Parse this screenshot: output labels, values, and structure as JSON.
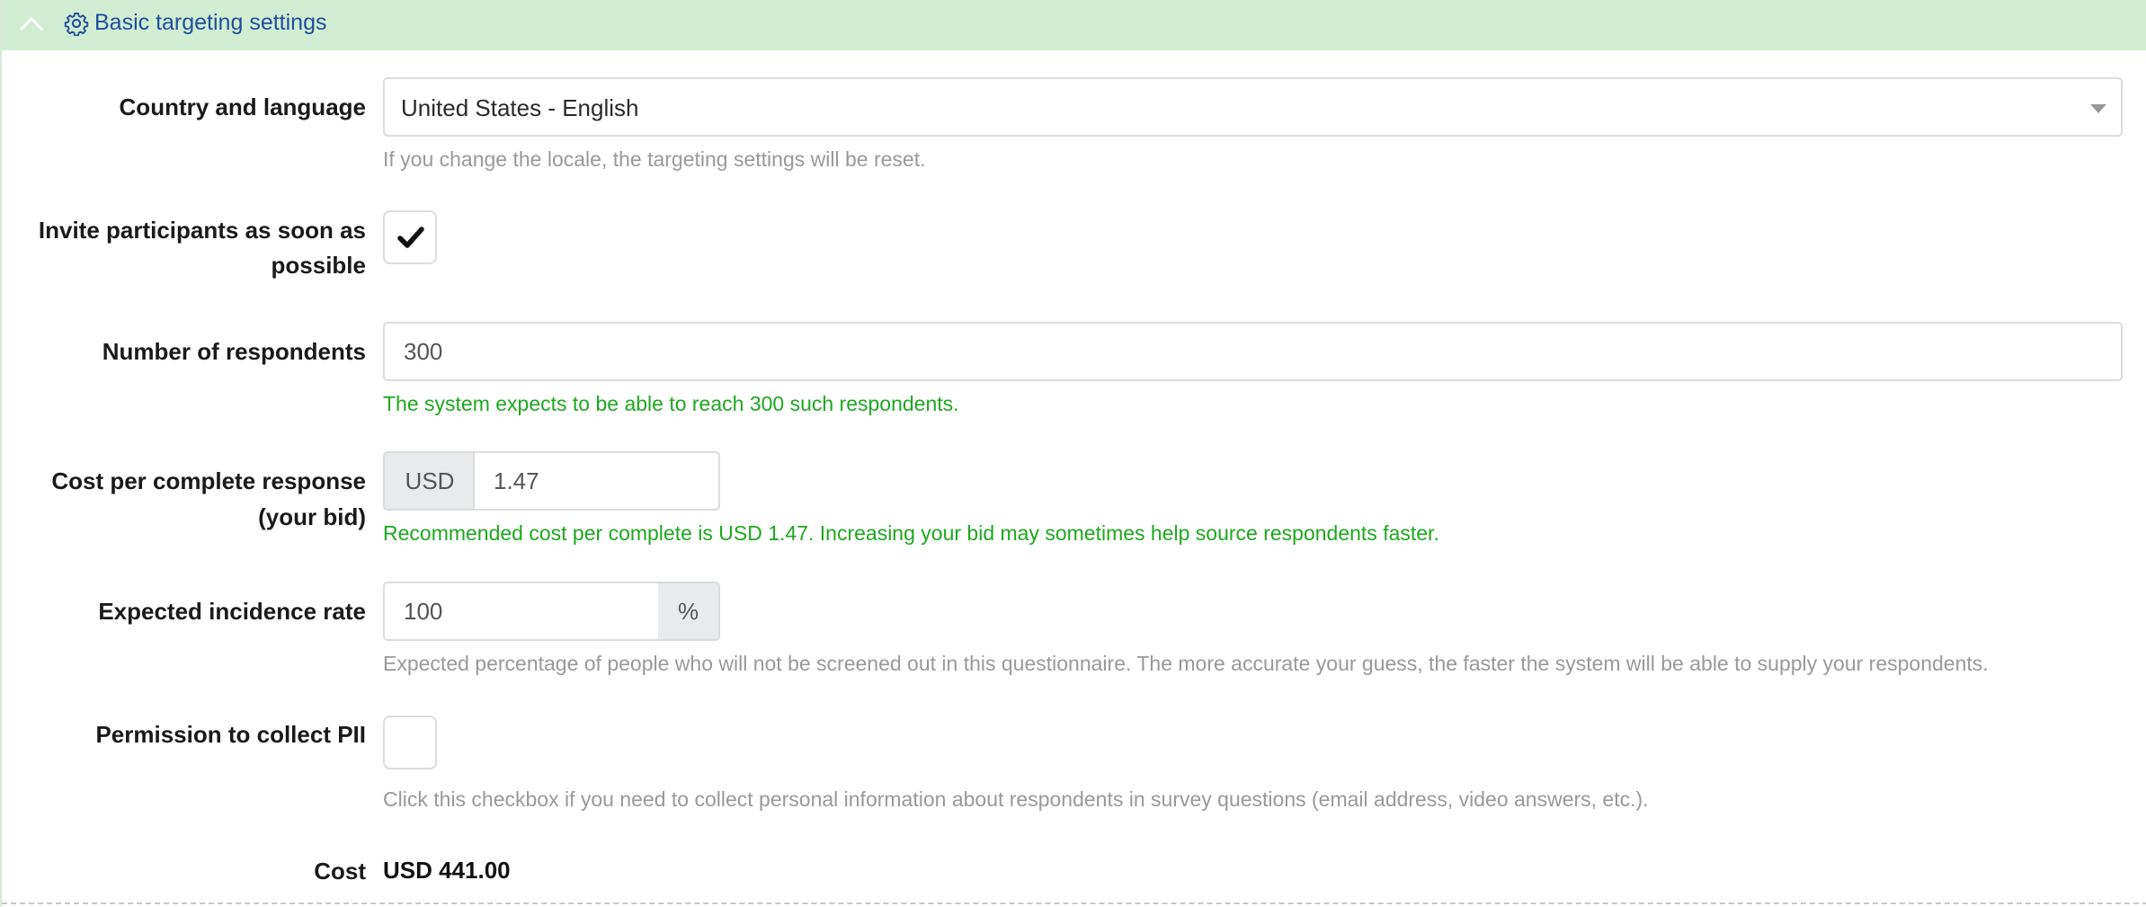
{
  "section": {
    "title": "Basic targeting settings",
    "toggle_icon": "chevron-up-icon",
    "title_icon": "gear-icon",
    "header_color": "#d1eed2",
    "title_color": "#1f4e9c"
  },
  "fields": {
    "country_language": {
      "label": "Country and language",
      "value": "United States - English",
      "help": "If you change the locale, the targeting settings will be reset."
    },
    "invite_asap": {
      "label_line1": "Invite participants as soon as",
      "label_line2": "possible",
      "checked": true
    },
    "respondents": {
      "label": "Number of respondents",
      "value": "300",
      "help": "The system expects to be able to reach 300 such respondents."
    },
    "cost_per_complete": {
      "label_line1": "Cost per complete response",
      "label_line2": "(your bid)",
      "currency": "USD",
      "value": "1.47",
      "help": "Recommended cost per complete is USD 1.47. Increasing your bid may sometimes help source respondents faster."
    },
    "incidence_rate": {
      "label": "Expected incidence rate",
      "value": "100",
      "unit": "%",
      "help": "Expected percentage of people who will not be screened out in this questionnaire. The more accurate your guess, the faster the system will be able to supply your respondents."
    },
    "pii": {
      "label": "Permission to collect PII",
      "checked": false,
      "help": "Click this checkbox if you need to collect personal information about respondents in survey questions (email address, video answers, etc.)."
    },
    "cost": {
      "label": "Cost",
      "value": "USD 441.00"
    }
  },
  "colors": {
    "help_gray": "#999999",
    "help_green": "#1ea81e",
    "input_border": "#dcdcdc",
    "addon_bg": "#e8eaec"
  }
}
